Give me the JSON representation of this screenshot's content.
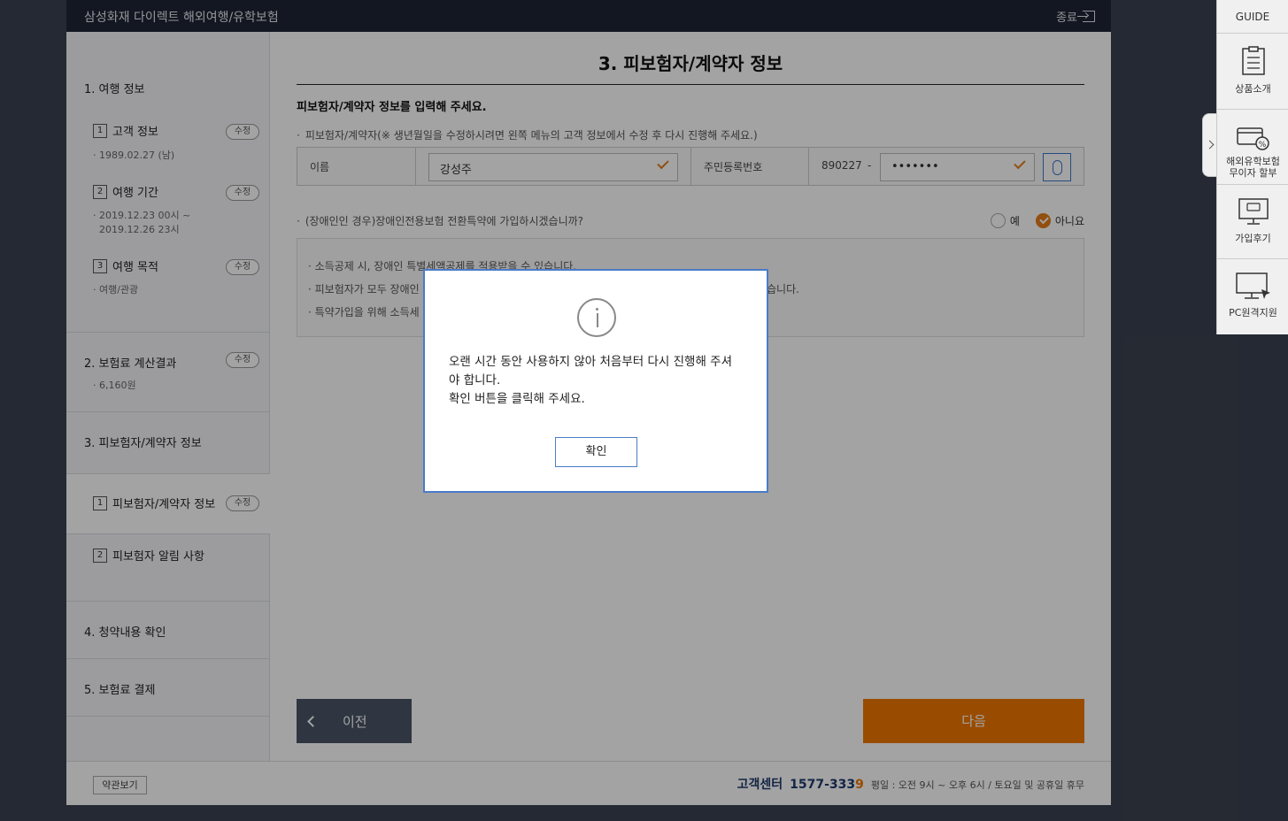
{
  "titlebar": {
    "title": "삼성화재 다이렉트 해외여행/유학보험",
    "exit_label": "종료"
  },
  "sidebar": {
    "step1": {
      "heading": "1. 여행 정보",
      "sub1": {
        "num": "1",
        "label": "고객 정보",
        "edit": "수정",
        "detail": "· 1989.02.27 (남)"
      },
      "sub2": {
        "num": "2",
        "label": "여행 기간",
        "edit": "수정",
        "detail_line1": "· 2019.12.23 00시 ~",
        "detail_line2": "2019.12.26 23시"
      },
      "sub3": {
        "num": "3",
        "label": "여행 목적",
        "edit": "수정",
        "detail": "· 여행/관광"
      }
    },
    "step2": {
      "heading": "2. 보험료 계산결과",
      "edit": "수정",
      "detail": "· 6,160원"
    },
    "step3": {
      "heading": "3. 피보험자/계약자 정보",
      "sub1": {
        "num": "1",
        "label": "피보험자/계약자 정보",
        "edit": "수정"
      },
      "sub2": {
        "num": "2",
        "label": "피보험자 알림 사항"
      }
    },
    "step4": {
      "heading": "4. 청약내용 확인"
    },
    "step5": {
      "heading": "5. 보험료 결제"
    }
  },
  "main": {
    "page_title": "3. 피보험자/계약자 정보",
    "section_title": "피보험자/계약자 정보를 입력해 주세요.",
    "note": "피보험자/계약자(※ 생년월일을 수정하시려면 왼쪽 메뉴의 고객 정보에서 수정 후 다시 진행해 주세요.)",
    "form": {
      "name_label": "이름",
      "name_value": "강성주",
      "rrn_label": "주민등록번호",
      "rrn_front": "890227",
      "rrn_dash": "-",
      "rrn_back": "•••••••"
    },
    "disability_question": "(장애인인 경우)장애인전용보험 전환특약에 가입하시겠습니까?",
    "radio_yes": "예",
    "radio_no": "아니요",
    "info_lines": [
      "소득공제 시, 장애인 특별세액공제를 적용받을 수 있습니다.",
      "피보험자가 모두 장애인",
      "특약가입을 위해 소득세"
    ],
    "info_line2_tail": "습니다.",
    "prev_label": "이전",
    "next_label": "다음"
  },
  "footer": {
    "terms_label": "약관보기",
    "cs_label": "고객센터",
    "cs_phone_main": "1577-333",
    "cs_phone_last": "9",
    "cs_hours": "평일 : 오전 9시 ~ 오후 6시 / 토요일 및 공휴일 휴무"
  },
  "guide": {
    "head": "GUIDE",
    "items": [
      "상품소개",
      "해외유학보험",
      "무이자 할부",
      "가입후기",
      "PC원격지원"
    ]
  },
  "modal": {
    "message_line1": "오랜 시간 동안 사용하지 않아 처음부터 다시 진행해 주셔",
    "message_line2": "야 합니다.",
    "message_line3": "확인 버튼을 클릭해 주세요.",
    "ok_label": "확인"
  },
  "colors": {
    "accent_orange": "#f07800",
    "modal_border": "#4a7bc8",
    "titlebar_bg": "#1e2535"
  }
}
